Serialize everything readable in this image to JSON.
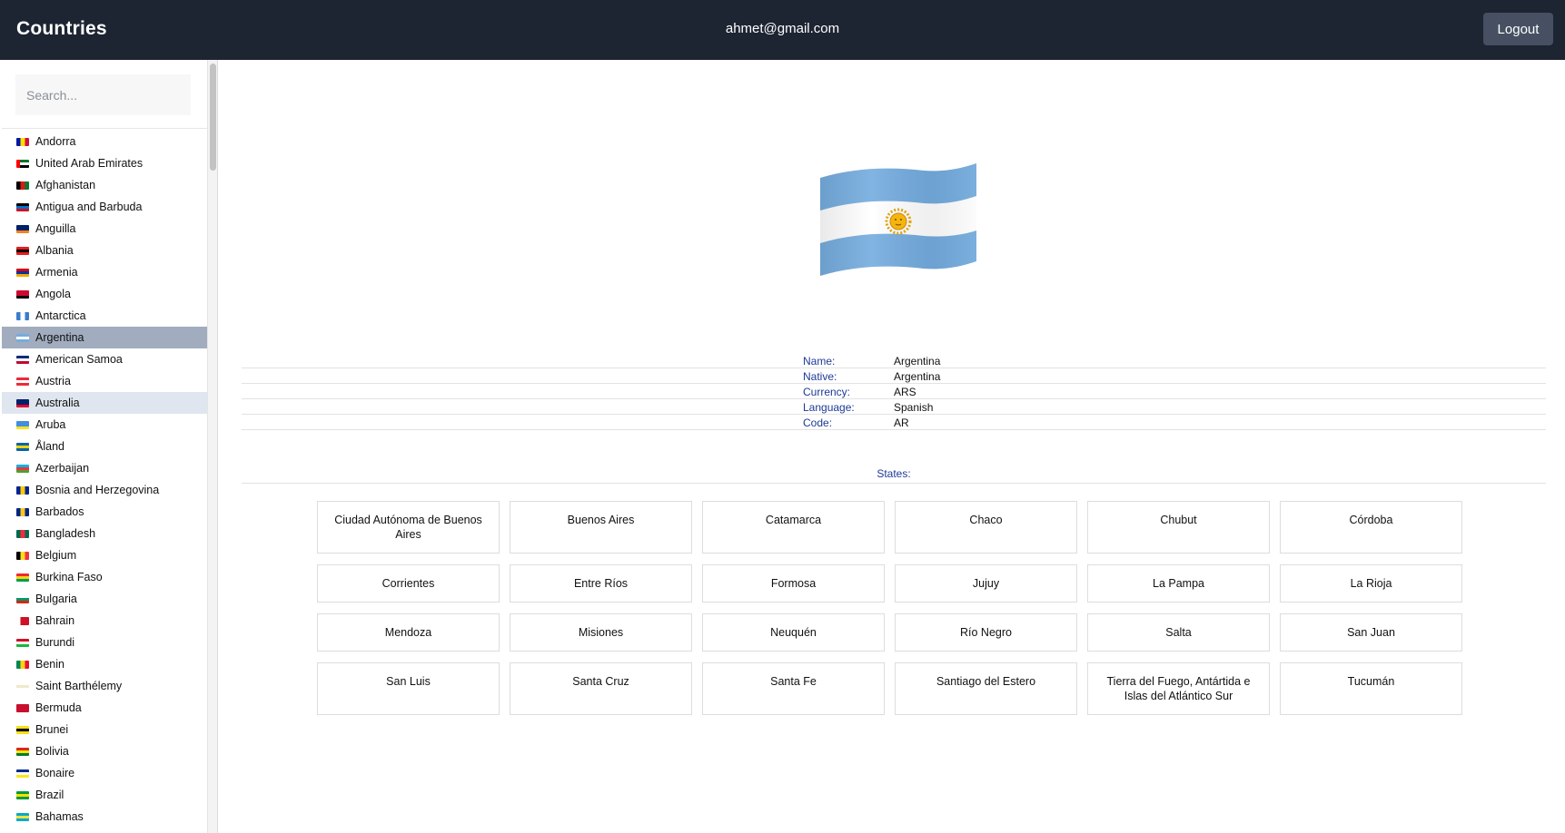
{
  "header": {
    "title": "Countries",
    "user_email": "ahmet@gmail.com",
    "logout_label": "Logout"
  },
  "sidebar": {
    "search_placeholder": "Search...",
    "selected": "Argentina",
    "hovered": "Australia",
    "countries": [
      {
        "name": "Andorra",
        "flag": [
          "#0018a8",
          "#fedf00",
          "#d0103a"
        ],
        "flag_dir": "v"
      },
      {
        "name": "United Arab Emirates",
        "flag": [
          "#00732f",
          "#ffffff",
          "#000000"
        ],
        "flag_dir": "h",
        "hoist": "#ff0000"
      },
      {
        "name": "Afghanistan",
        "flag": [
          "#000000",
          "#d32011",
          "#007a36"
        ],
        "flag_dir": "v"
      },
      {
        "name": "Antigua and Barbuda",
        "flag": [
          "#000000",
          "#0072c6",
          "#ce1126"
        ],
        "flag_dir": "h"
      },
      {
        "name": "Anguilla",
        "flag": [
          "#012169",
          "#012169",
          "#f58220"
        ],
        "flag_dir": "h"
      },
      {
        "name": "Albania",
        "flag": [
          "#e41e20",
          "#000000",
          "#e41e20"
        ],
        "flag_dir": "h"
      },
      {
        "name": "Armenia",
        "flag": [
          "#d90012",
          "#0033a0",
          "#f2a800"
        ],
        "flag_dir": "h"
      },
      {
        "name": "Angola",
        "flag": [
          "#cc092f",
          "#cc092f",
          "#000000"
        ],
        "flag_dir": "h"
      },
      {
        "name": "Antarctica",
        "flag": [
          "#3a7dce",
          "#ffffff",
          "#3a7dce"
        ],
        "flag_dir": "v"
      },
      {
        "name": "Argentina",
        "flag": [
          "#74acdf",
          "#ffffff",
          "#74acdf"
        ],
        "flag_dir": "h"
      },
      {
        "name": "American Samoa",
        "flag": [
          "#002b7f",
          "#ffffff",
          "#bf0a30"
        ],
        "flag_dir": "h"
      },
      {
        "name": "Austria",
        "flag": [
          "#ed2939",
          "#ffffff",
          "#ed2939"
        ],
        "flag_dir": "h"
      },
      {
        "name": "Australia",
        "flag": [
          "#012169",
          "#012169",
          "#e4002b"
        ],
        "flag_dir": "h"
      },
      {
        "name": "Aruba",
        "flag": [
          "#418fde",
          "#418fde",
          "#fbe122"
        ],
        "flag_dir": "h"
      },
      {
        "name": "Åland",
        "flag": [
          "#0064ad",
          "#ffd300",
          "#0064ad"
        ],
        "flag_dir": "h"
      },
      {
        "name": "Azerbaijan",
        "flag": [
          "#00b5e2",
          "#ef3340",
          "#509e2f"
        ],
        "flag_dir": "h"
      },
      {
        "name": "Bosnia and Herzegovina",
        "flag": [
          "#002395",
          "#fecb00",
          "#002395"
        ],
        "flag_dir": "v"
      },
      {
        "name": "Barbados",
        "flag": [
          "#00267f",
          "#ffc726",
          "#00267f"
        ],
        "flag_dir": "v"
      },
      {
        "name": "Bangladesh",
        "flag": [
          "#006a4e",
          "#f42a41",
          "#006a4e"
        ],
        "flag_dir": "v"
      },
      {
        "name": "Belgium",
        "flag": [
          "#000000",
          "#fdda24",
          "#ef3340"
        ],
        "flag_dir": "v"
      },
      {
        "name": "Burkina Faso",
        "flag": [
          "#ef2b2d",
          "#fcd116",
          "#009e49"
        ],
        "flag_dir": "h"
      },
      {
        "name": "Bulgaria",
        "flag": [
          "#ffffff",
          "#00966e",
          "#d62612"
        ],
        "flag_dir": "h"
      },
      {
        "name": "Bahrain",
        "flag": [
          "#ffffff",
          "#ce1126",
          "#ce1126"
        ],
        "flag_dir": "v"
      },
      {
        "name": "Burundi",
        "flag": [
          "#ce1126",
          "#ffffff",
          "#1eb53a"
        ],
        "flag_dir": "h"
      },
      {
        "name": "Benin",
        "flag": [
          "#008751",
          "#fcd116",
          "#e8112d"
        ],
        "flag_dir": "v"
      },
      {
        "name": "Saint Barthélemy",
        "flag": [
          "#ffffff",
          "#f2e8c9",
          "#ffffff"
        ],
        "flag_dir": "h"
      },
      {
        "name": "Bermuda",
        "flag": [
          "#c8102e",
          "#c8102e",
          "#c8102e"
        ],
        "flag_dir": "h"
      },
      {
        "name": "Brunei",
        "flag": [
          "#f7e017",
          "#000000",
          "#f7e017"
        ],
        "flag_dir": "h"
      },
      {
        "name": "Bolivia",
        "flag": [
          "#d52b1e",
          "#f9e300",
          "#007934"
        ],
        "flag_dir": "h"
      },
      {
        "name": "Bonaire",
        "flag": [
          "#012a87",
          "#ffffff",
          "#f9e814"
        ],
        "flag_dir": "h"
      },
      {
        "name": "Brazil",
        "flag": [
          "#009b3a",
          "#fedf00",
          "#009b3a"
        ],
        "flag_dir": "h"
      },
      {
        "name": "Bahamas",
        "flag": [
          "#00abc9",
          "#fae042",
          "#00abc9"
        ],
        "flag_dir": "h"
      }
    ]
  },
  "country": {
    "flag_colors": {
      "blue": "#74acdf",
      "white": "#ffffff",
      "sun": "#f6b40e"
    },
    "details": [
      {
        "label": "Name:",
        "value": "Argentina"
      },
      {
        "label": "Native:",
        "value": "Argentina"
      },
      {
        "label": "Currency:",
        "value": "ARS"
      },
      {
        "label": "Language:",
        "value": "Spanish"
      },
      {
        "label": "Code:",
        "value": "AR"
      }
    ],
    "states_label": "States:",
    "states": [
      "Ciudad Autónoma de Buenos Aires",
      "Buenos Aires",
      "Catamarca",
      "Chaco",
      "Chubut",
      "Córdoba",
      "Corrientes",
      "Entre Ríos",
      "Formosa",
      "Jujuy",
      "La Pampa",
      "La Rioja",
      "Mendoza",
      "Misiones",
      "Neuquén",
      "Río Negro",
      "Salta",
      "San Juan",
      "San Luis",
      "Santa Cruz",
      "Santa Fe",
      "Santiago del Estero",
      "Tierra del Fuego, Antártida e Islas del Atlántico Sur",
      "Tucumán"
    ]
  }
}
